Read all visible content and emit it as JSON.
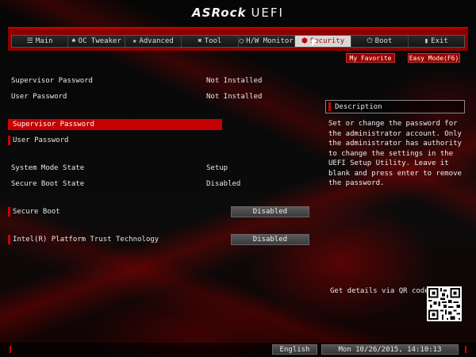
{
  "header": {
    "brand": "ASRock",
    "product": "UEFI"
  },
  "tabs": [
    {
      "label": "Main",
      "icon": "list-icon",
      "glyph": "☰"
    },
    {
      "label": "OC Tweaker",
      "icon": "rocket-icon",
      "glyph": "♠"
    },
    {
      "label": "Advanced",
      "icon": "star-icon",
      "glyph": "★"
    },
    {
      "label": "Tool",
      "icon": "tools-icon",
      "glyph": "✖"
    },
    {
      "label": "H/W Monitor",
      "icon": "monitor-icon",
      "glyph": "◯"
    },
    {
      "label": "Security",
      "icon": "shield-icon",
      "glyph": "⬢",
      "active": true
    },
    {
      "label": "Boot",
      "icon": "power-icon",
      "glyph": "⏻"
    },
    {
      "label": "Exit",
      "icon": "exit-icon",
      "glyph": "▮"
    }
  ],
  "quick_buttons": {
    "favorite": "My Favorite",
    "easy_mode": "Easy Mode(F6)"
  },
  "info": {
    "supervisor_label": "Supervisor Password",
    "supervisor_value": "Not Installed",
    "user_label": "User Password",
    "user_value": "Not Installed"
  },
  "actions": {
    "supervisor_password": "Supervisor Password",
    "user_password": "User Password"
  },
  "state": {
    "system_mode_label": "System Mode State",
    "system_mode_value": "Setup",
    "secure_boot_state_label": "Secure Boot State",
    "secure_boot_state_value": "Disabled"
  },
  "options": {
    "secure_boot_label": "Secure Boot",
    "secure_boot_value": "Disabled",
    "ptt_label": "Intel(R) Platform Trust Technology",
    "ptt_value": "Disabled"
  },
  "description": {
    "title": "Description",
    "text": "Set or change the password for the administrator account. Only the administrator has authority to change the settings in the UEFI Setup Utility. Leave it blank and press enter to remove the password.",
    "qr_label": "Get details via QR code"
  },
  "status": {
    "language": "English",
    "datetime": "Mon 10/26/2015, 14:10:13"
  },
  "colors": {
    "accent": "#c40000",
    "tab_active_bg": "#d8d8d8",
    "background": "#000000"
  }
}
